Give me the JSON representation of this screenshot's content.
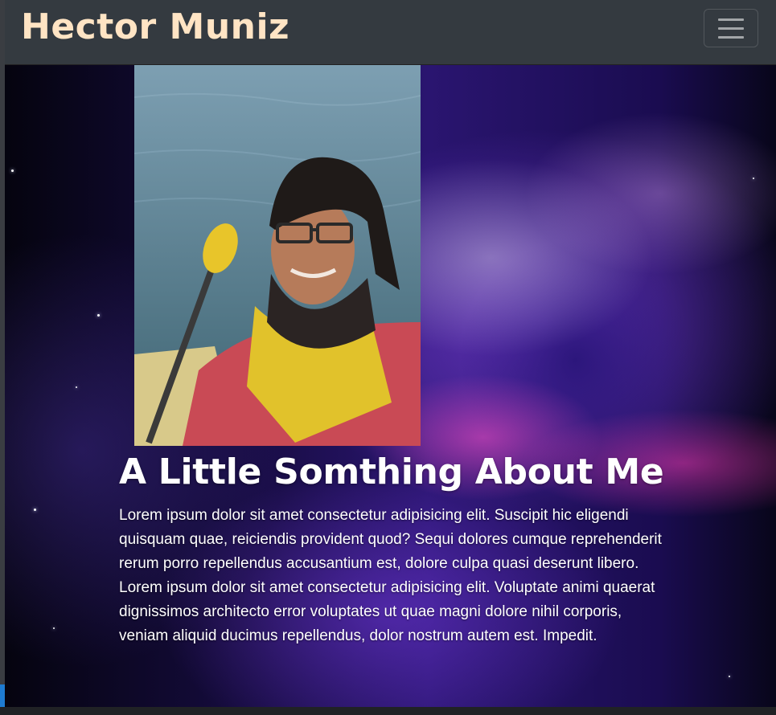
{
  "navbar": {
    "brand": "Hector Muniz",
    "toggler_icon": "hamburger-menu-icon"
  },
  "hero": {
    "photo_alt": "Hector Muniz kayaking",
    "title": "A Little Somthing About Me",
    "paragraph": "Lorem ipsum dolor sit amet consectetur adipisicing elit. Suscipit hic eligendi quisquam quae, reiciendis provident quod? Sequi dolores cumque reprehenderit rerum porro repellendus accusantium est, dolore culpa quasi deserunt libero. Lorem ipsum dolor sit amet consectetur adipisicing elit. Voluptate animi quaerat dignissimos architecto error voluptates ut quae magni dolore nihil corporis, veniam aliquid ducimus repellendus, dolor nostrum autem est. Impedit."
  },
  "colors": {
    "navbar_bg": "#343a40",
    "brand": "#ffe4c4",
    "text": "#ffffff"
  }
}
